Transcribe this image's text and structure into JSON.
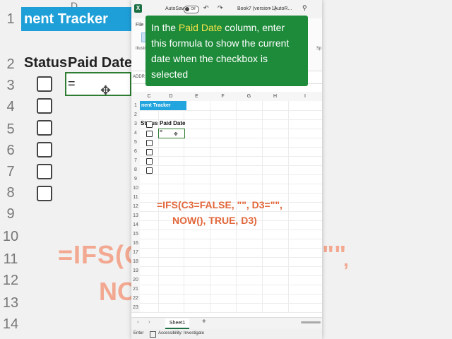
{
  "background": {
    "title_fragment": "nent Tracker",
    "col_letter": "D",
    "row_numbers": [
      "1",
      "2",
      "3",
      "4",
      "5",
      "6",
      "7",
      "8",
      "9",
      "10",
      "11",
      "12",
      "13",
      "14"
    ],
    "headers": {
      "status": "Status",
      "paid_date": "Paid Date"
    },
    "cell_d3_value": "=",
    "formula_line1": "=IFS(C",
    "formula_quote": "\"\"",
    "formula_comma": ",",
    "formula_line2": "NO"
  },
  "titlebar": {
    "app_icon": "X",
    "autosave_label": "AutoSave",
    "autosave_state": "Off",
    "doc_name": "Book7 (version 1)",
    "separator": "•",
    "app_name": "AutoR...",
    "search_icon": "search-icon"
  },
  "ribbon": {
    "file_tab": "File",
    "illustrations": "Illustr",
    "sp_fragment": "Sp"
  },
  "namebox": {
    "text": "ADDR"
  },
  "grid": {
    "columns": [
      "C",
      "D",
      "E",
      "F",
      "G",
      "H",
      "I"
    ],
    "row_numbers": [
      "1",
      "2",
      "3",
      "4",
      "5",
      "6",
      "7",
      "8",
      "9",
      "10",
      "11",
      "12",
      "13",
      "14",
      "15",
      "16",
      "17",
      "18",
      "19",
      "20",
      "21",
      "22",
      "23"
    ],
    "title_cell": "nent Tracker",
    "header_status": "Status",
    "header_paid_date": "Paid Date",
    "cell_d3_value": "=",
    "cursor_glyph": "✥",
    "checkbox_rows": [
      3,
      4,
      5,
      6,
      7,
      8
    ]
  },
  "formula_text": {
    "line1": "=IFS(C3=FALSE, \"\", D3=\"\",",
    "line2": "NOW(), TRUE, D3)"
  },
  "sheetbar": {
    "tab": "Sheet1",
    "add": "+",
    "prev": "‹",
    "next": "›"
  },
  "statusbar": {
    "mode": "Enter",
    "accessibility": "Accessibility: Investigate"
  },
  "tooltip": {
    "before": "In the ",
    "highlight": "Paid Date",
    "after": " column, enter this formula to show the current date when the checkbox is selected"
  },
  "colors": {
    "tooltip_bg": "#1e8b3a",
    "highlight": "#f6e34b",
    "formula": "#e2673a",
    "title_cell": "#22a5de",
    "excel_green": "#1d7044"
  }
}
